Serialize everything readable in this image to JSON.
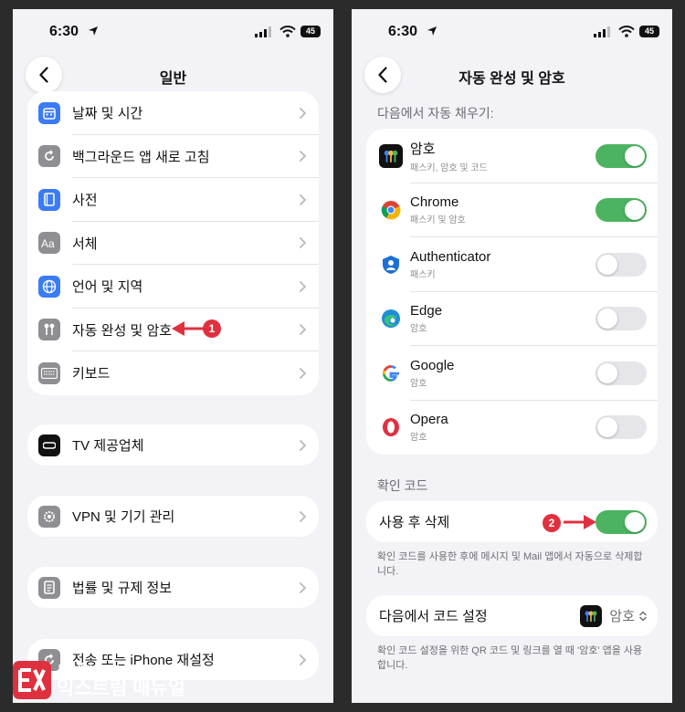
{
  "left": {
    "status_time": "6:30",
    "battery": "45",
    "nav_title": "일반",
    "group1": [
      {
        "label": "날짜 및 시간",
        "icon": "calendar-icon",
        "color": "#3b7bf6"
      },
      {
        "label": "백그라운드 앱 새로 고침",
        "icon": "refresh-icon",
        "color": "#8e8e93"
      },
      {
        "label": "사전",
        "icon": "book-icon",
        "color": "#3b7bf6"
      },
      {
        "label": "서체",
        "icon": "font-icon",
        "color": "#8e8e93"
      },
      {
        "label": "언어 및 지역",
        "icon": "globe-icon",
        "color": "#3b7bf6"
      },
      {
        "label": "자동 완성 및 암호",
        "icon": "keys-icon",
        "color": "#8e8e93"
      },
      {
        "label": "키보드",
        "icon": "keyboard-icon",
        "color": "#8e8e93"
      }
    ],
    "tv_provider": "TV 제공업체",
    "vpn": "VPN 및 기기 관리",
    "legal": "법률 및 규제 정보",
    "reset": "전송 또는 iPhone 재설정",
    "badge1": "1"
  },
  "right": {
    "status_time": "6:30",
    "battery": "45",
    "nav_title": "자동 완성 및 암호",
    "autofill_header": "다음에서 자동 채우기:",
    "apps": [
      {
        "name": "암호",
        "sub": "패스키, 암호 및 코드",
        "on": true,
        "icon": "passwords-app-icon"
      },
      {
        "name": "Chrome",
        "sub": "패스키 및 암호",
        "on": true,
        "icon": "chrome-icon"
      },
      {
        "name": "Authenticator",
        "sub": "패스키",
        "on": false,
        "icon": "authenticator-icon"
      },
      {
        "name": "Edge",
        "sub": "암호",
        "on": false,
        "icon": "edge-icon"
      },
      {
        "name": "Google",
        "sub": "암호",
        "on": false,
        "icon": "google-icon"
      },
      {
        "name": "Opera",
        "sub": "암호",
        "on": false,
        "icon": "opera-icon"
      }
    ],
    "verify_header": "확인 코드",
    "delete_after_use": "사용 후 삭제",
    "delete_on": true,
    "delete_footer": "확인 코드를 사용한 후에 메시지 및 Mail 앱에서 자동으로 삭제합니다.",
    "set_code_label": "다음에서 코드 설정",
    "set_code_value": "암호",
    "set_code_footer": "확인 코드 설정을 위한 QR 코드 및 링크를 열 때 '암호' 앱을 사용합니다.",
    "badge2": "2"
  },
  "brand": {
    "tagline": "More Better IT Life",
    "name": "익스트림 매뉴얼"
  },
  "colors": {
    "accent_red": "#e0303f",
    "toggle_on": "#4cb461",
    "background": "#f2f2f7"
  }
}
